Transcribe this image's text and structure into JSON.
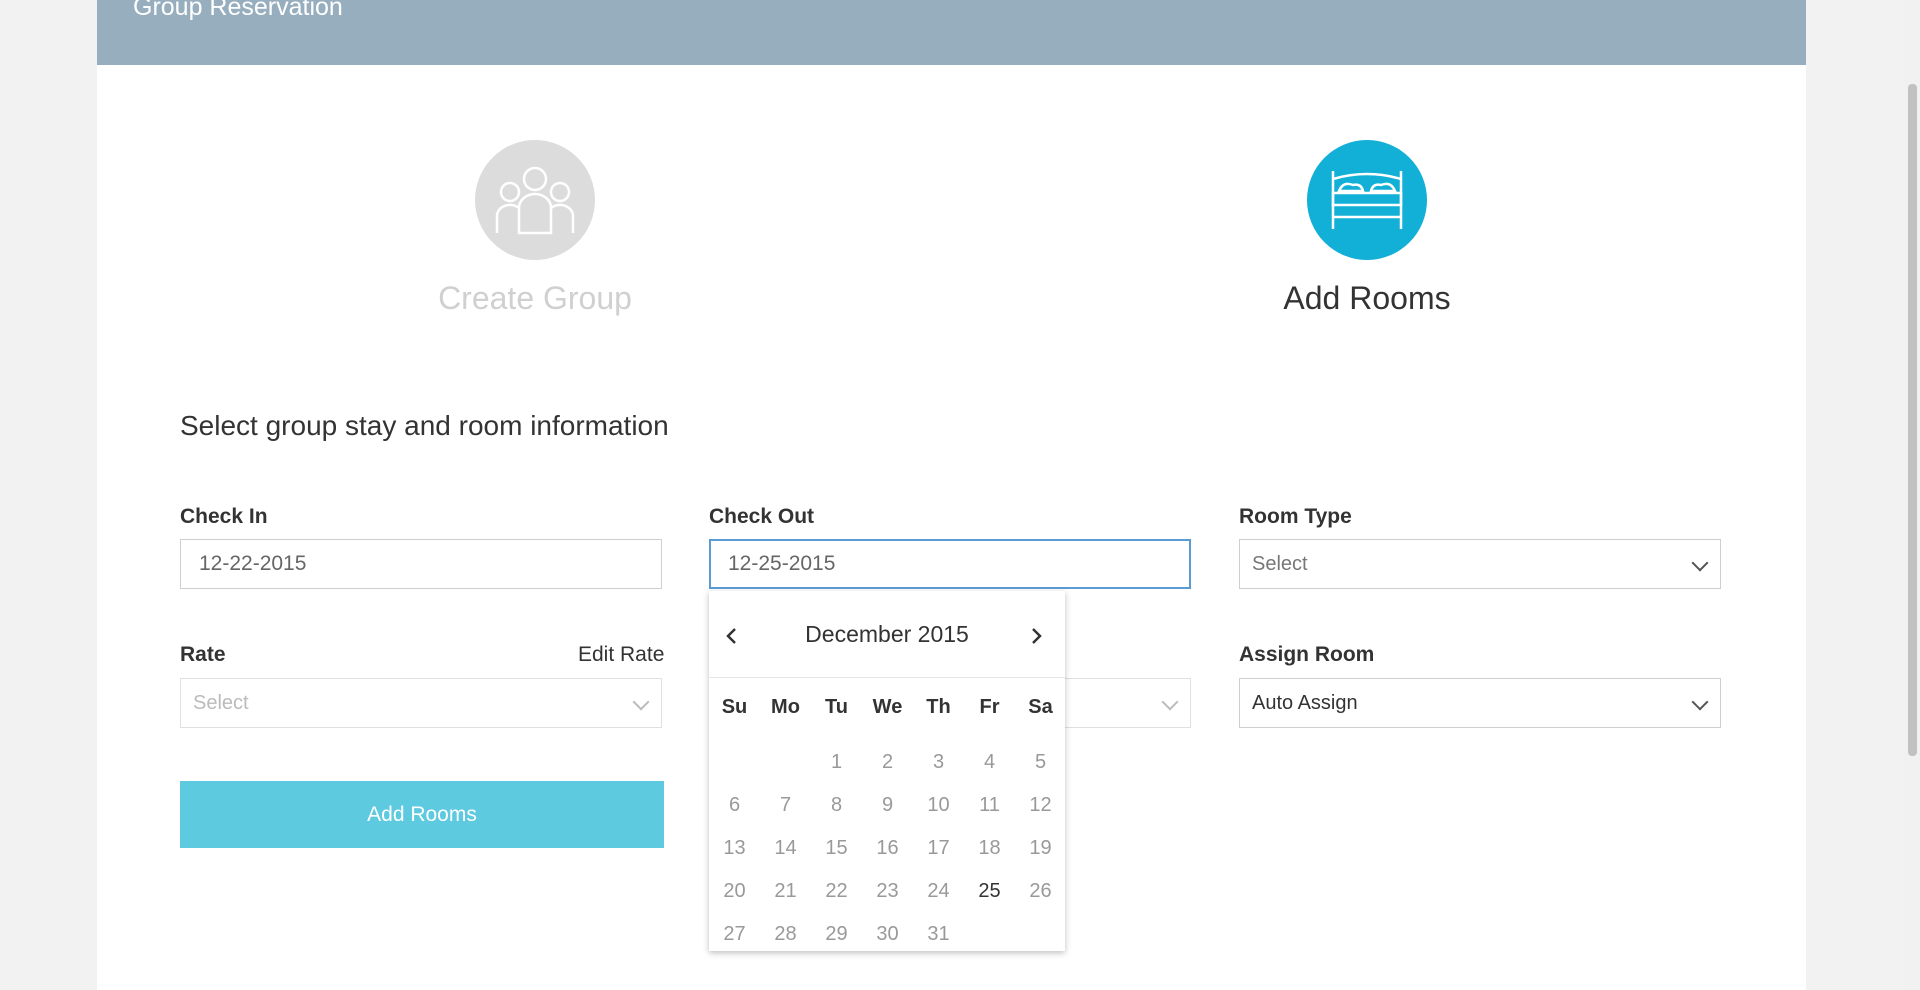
{
  "header": {
    "title": "Group Reservation"
  },
  "steps": [
    {
      "label": "Create Group",
      "icon": "group-icon",
      "state": "inactive"
    },
    {
      "label": "Add Rooms",
      "icon": "bed-icon",
      "state": "active"
    }
  ],
  "section_title": "Select group stay and room information",
  "fields": {
    "check_in": {
      "label": "Check In",
      "value": "12-22-2015"
    },
    "check_out": {
      "label": "Check Out",
      "value": "12-25-2015"
    },
    "room_type": {
      "label": "Room Type",
      "value": "Select"
    },
    "rate": {
      "label": "Rate",
      "value": "Select",
      "edit_label": "Edit Rate"
    },
    "assign_room": {
      "label": "Assign Room",
      "value": "Auto Assign"
    }
  },
  "add_rooms_button": "Add Rooms",
  "calendar": {
    "month": "December 2015",
    "weekdays": [
      "Su",
      "Mo",
      "Tu",
      "We",
      "Th",
      "Fr",
      "Sa"
    ],
    "selected_day": "25",
    "weeks": [
      [
        "",
        "",
        "1",
        "2",
        "3",
        "4",
        "5"
      ],
      [
        "6",
        "7",
        "8",
        "9",
        "10",
        "11",
        "12"
      ],
      [
        "13",
        "14",
        "15",
        "16",
        "17",
        "18",
        "19"
      ],
      [
        "20",
        "21",
        "22",
        "23",
        "24",
        "25",
        "26"
      ],
      [
        "27",
        "28",
        "29",
        "30",
        "31",
        "",
        ""
      ]
    ]
  },
  "colors": {
    "header_bg": "#97aebf",
    "accent": "#12b0d6",
    "button_bg": "#5ecae0",
    "focus_border": "#5b9bd5"
  }
}
